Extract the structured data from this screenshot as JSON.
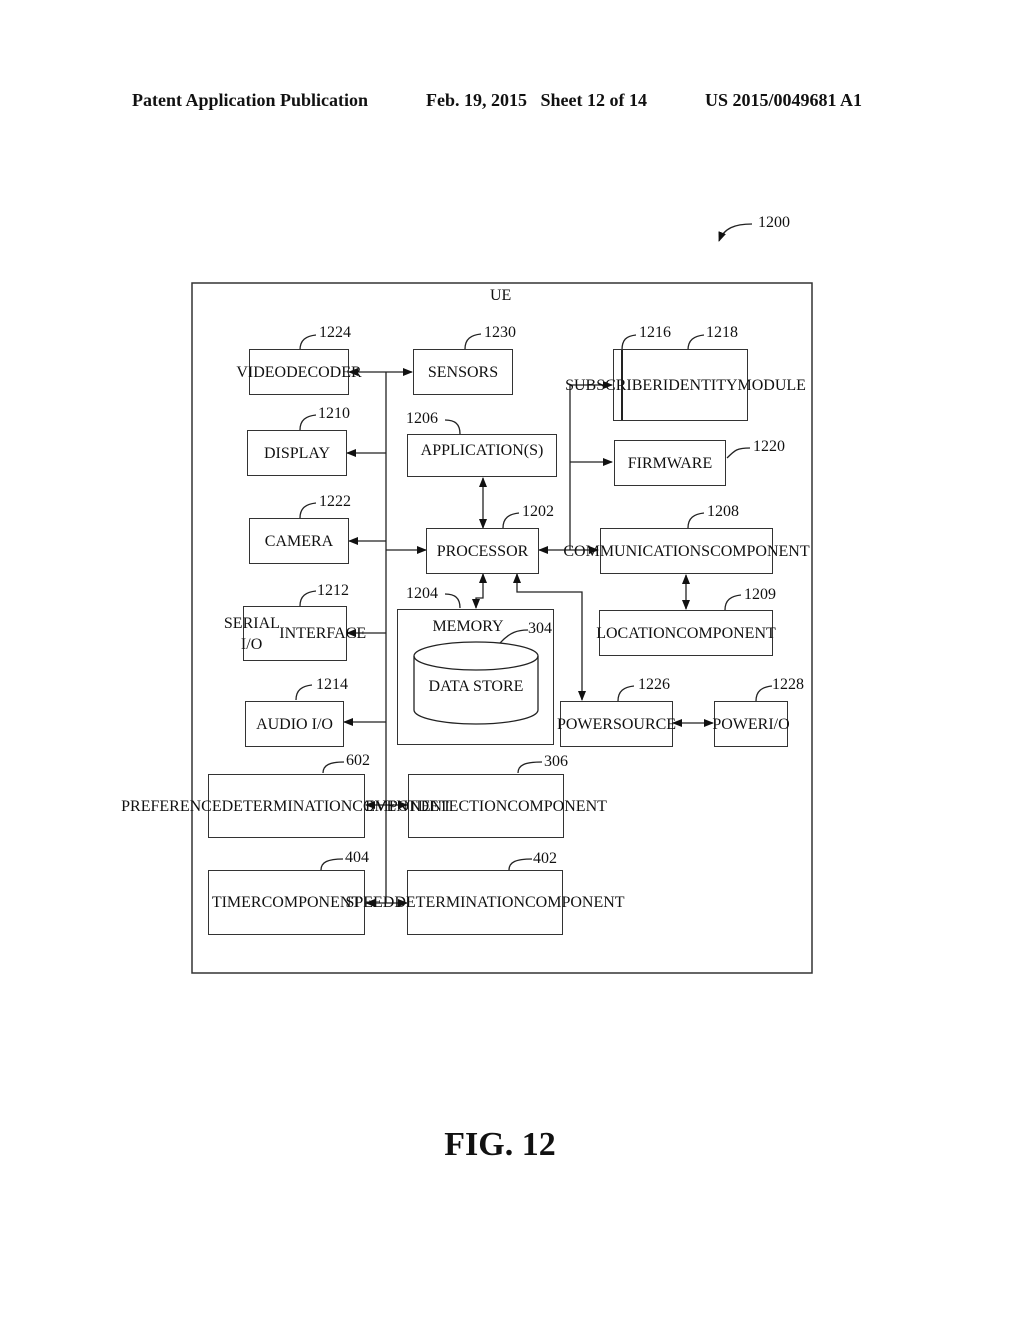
{
  "header": {
    "publication": "Patent Application Publication",
    "date_sheet": "Feb. 19, 2015   Sheet 12 of 14",
    "patent_number": "US 2015/0049681 A1"
  },
  "figure": {
    "ref": "1200",
    "container_label": "UE",
    "caption": "FIG. 12"
  },
  "blocks": {
    "video_decoder": {
      "lines": [
        "VIDEO",
        "DECODER"
      ],
      "ref": "1224"
    },
    "sensors": {
      "lines": [
        "SENSORS"
      ],
      "ref": "1230"
    },
    "display": {
      "lines": [
        "DISPLAY"
      ],
      "ref": "1210"
    },
    "applications": {
      "lines": [
        "APPLICATION(S)"
      ],
      "ref": "1206"
    },
    "subscriber_identity_module": {
      "lines": [
        "SUBSCRIBER",
        "IDENTITY",
        "MODULE"
      ],
      "ref_outer": "1216",
      "ref_inner": "1218"
    },
    "firmware": {
      "lines": [
        "FIRMWARE"
      ],
      "ref": "1220"
    },
    "camera": {
      "lines": [
        "CAMERA"
      ],
      "ref": "1222"
    },
    "processor": {
      "lines": [
        "PROCESSOR"
      ],
      "ref": "1202"
    },
    "communications": {
      "lines": [
        "COMMUNICATIONS",
        "COMPONENT"
      ],
      "ref": "1208"
    },
    "serial_io": {
      "lines": [
        "SERIAL I/O",
        "INTERFACE"
      ],
      "ref": "1212"
    },
    "memory": {
      "lines": [
        "MEMORY"
      ],
      "ref": "1204"
    },
    "data_store": {
      "lines": [
        "DATA STORE"
      ],
      "ref": "304"
    },
    "location": {
      "lines": [
        "LOCATION",
        "COMPONENT"
      ],
      "ref": "1209"
    },
    "audio_io": {
      "lines": [
        "AUDIO I/O"
      ],
      "ref": "1214"
    },
    "power_source": {
      "lines": [
        "POWER",
        "SOURCE"
      ],
      "ref": "1226"
    },
    "power_io": {
      "lines": [
        "POWER",
        "I/O"
      ],
      "ref": "1228"
    },
    "preference": {
      "lines": [
        "PREFERENCE",
        "DETERMINATION",
        "COMPONENT"
      ],
      "ref": "602"
    },
    "event_detection": {
      "lines": [
        "EVENT",
        "DETECTION",
        "COMPONENT"
      ],
      "ref": "306"
    },
    "timer": {
      "lines": [
        "TIMER",
        "COMPONENT"
      ],
      "ref": "404"
    },
    "speed": {
      "lines": [
        "SPEED",
        "DETERMINATION",
        "COMPONENT"
      ],
      "ref": "402"
    }
  }
}
